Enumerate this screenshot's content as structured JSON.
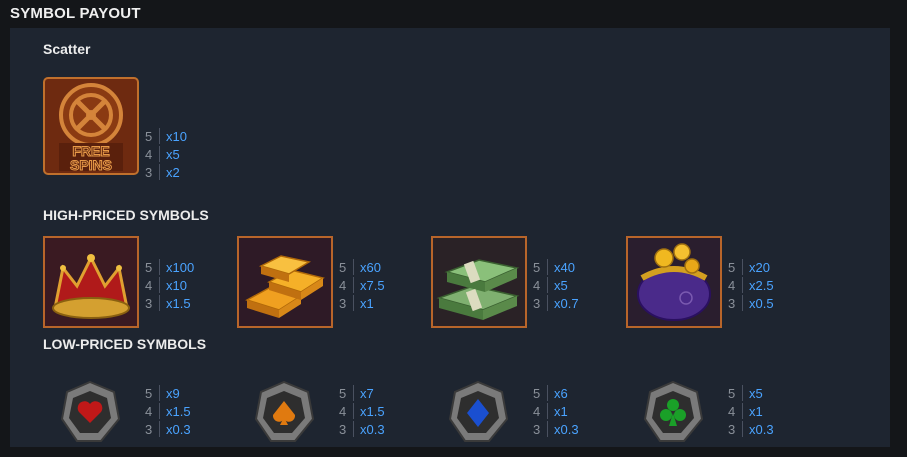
{
  "page_title": "SYMBOL PAYOUT",
  "scatter": {
    "title": "Scatter",
    "icon": "free-spins-icon",
    "icon_text_line1": "FREE",
    "icon_text_line2": "SPINS",
    "payouts": [
      {
        "count": "5",
        "value": "x10"
      },
      {
        "count": "4",
        "value": "x5"
      },
      {
        "count": "3",
        "value": "x2"
      }
    ]
  },
  "high": {
    "title": "HIGH-PRICED SYMBOLS",
    "symbols": [
      {
        "icon": "crown-icon",
        "payouts": [
          {
            "count": "5",
            "value": "x100"
          },
          {
            "count": "4",
            "value": "x10"
          },
          {
            "count": "3",
            "value": "x1.5"
          }
        ]
      },
      {
        "icon": "gold-bars-icon",
        "payouts": [
          {
            "count": "5",
            "value": "x60"
          },
          {
            "count": "4",
            "value": "x7.5"
          },
          {
            "count": "3",
            "value": "x1"
          }
        ]
      },
      {
        "icon": "cash-stacks-icon",
        "payouts": [
          {
            "count": "5",
            "value": "x40"
          },
          {
            "count": "4",
            "value": "x5"
          },
          {
            "count": "3",
            "value": "x0.7"
          }
        ]
      },
      {
        "icon": "coin-purse-icon",
        "payouts": [
          {
            "count": "5",
            "value": "x20"
          },
          {
            "count": "4",
            "value": "x2.5"
          },
          {
            "count": "3",
            "value": "x0.5"
          }
        ]
      }
    ]
  },
  "low": {
    "title": "LOW-PRICED SYMBOLS",
    "symbols": [
      {
        "icon": "heart-gem-icon",
        "gem_color": "#c01818",
        "payouts": [
          {
            "count": "5",
            "value": "x9"
          },
          {
            "count": "4",
            "value": "x1.5"
          },
          {
            "count": "3",
            "value": "x0.3"
          }
        ]
      },
      {
        "icon": "spade-gem-icon",
        "gem_color": "#e07a10",
        "payouts": [
          {
            "count": "5",
            "value": "x7"
          },
          {
            "count": "4",
            "value": "x1.5"
          },
          {
            "count": "3",
            "value": "x0.3"
          }
        ]
      },
      {
        "icon": "diamond-gem-icon",
        "gem_color": "#1a4fd0",
        "payouts": [
          {
            "count": "5",
            "value": "x6"
          },
          {
            "count": "4",
            "value": "x1"
          },
          {
            "count": "3",
            "value": "x0.3"
          }
        ]
      },
      {
        "icon": "club-gem-icon",
        "gem_color": "#1aa028",
        "payouts": [
          {
            "count": "5",
            "value": "x5"
          },
          {
            "count": "4",
            "value": "x1"
          },
          {
            "count": "3",
            "value": "x0.3"
          }
        ]
      }
    ]
  },
  "colors": {
    "background": "#141619",
    "panel": "#1e2530",
    "payout_value": "#4aa3ff",
    "frame_border": "#b8652a"
  }
}
